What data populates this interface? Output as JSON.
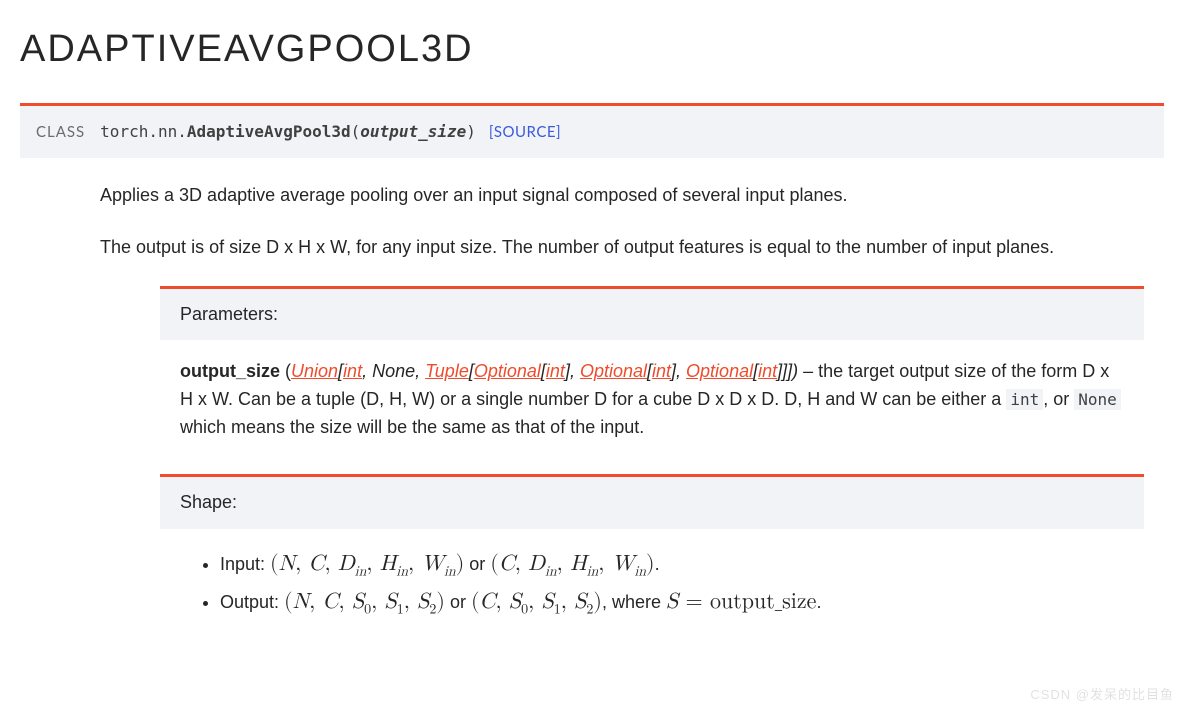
{
  "title": "ADAPTIVEAVGPOOL3D",
  "signature": {
    "class_kw": "CLASS",
    "path": "torch.nn.",
    "name": "AdaptiveAvgPool3d",
    "args_open": "(",
    "arg": "output_size",
    "args_close": ")",
    "source": "[SOURCE]"
  },
  "description1": "Applies a 3D adaptive average pooling over an input signal composed of several input planes.",
  "description2": "The output is of size D x H x W, for any input size. The number of output features is equal to the number of input planes.",
  "parameters": {
    "header": "Parameters:",
    "name": "output_size",
    "type_prefix": " (",
    "t1": "Union",
    "t_b1": "[",
    "t2": "int",
    "t_c1": ", ",
    "t3": "None",
    "t_c2": ", ",
    "t4": "Tuple",
    "t_b2": "[",
    "t5": "Optional",
    "t_b3": "[",
    "t6": "int",
    "t_b4": "], ",
    "t7": "Optional",
    "t_b5": "[",
    "t8": "int",
    "t_b6": "], ",
    "t9": "Optional",
    "t_b7": "[",
    "t10": "int",
    "t_b8": "]]]) – ",
    "desc_before_int": "the target output size of the form D x H x W. Can be a tuple (D, H, W) or a single number D for a cube D x D x D. D, H and W can be either a ",
    "code_int": "int",
    "mid": ", or ",
    "code_none": "None",
    "desc_after": " which means the size will be the same as that of the input."
  },
  "shape": {
    "header": "Shape:",
    "input_label": "Input: ",
    "input_or": " or ",
    "input_end": ".",
    "output_label": "Output: ",
    "output_or": " or ",
    "output_where": ", where ",
    "output_eq": " = ",
    "output_val": "output_size",
    "output_end": "."
  },
  "watermark": "CSDN @发呆的比目鱼"
}
